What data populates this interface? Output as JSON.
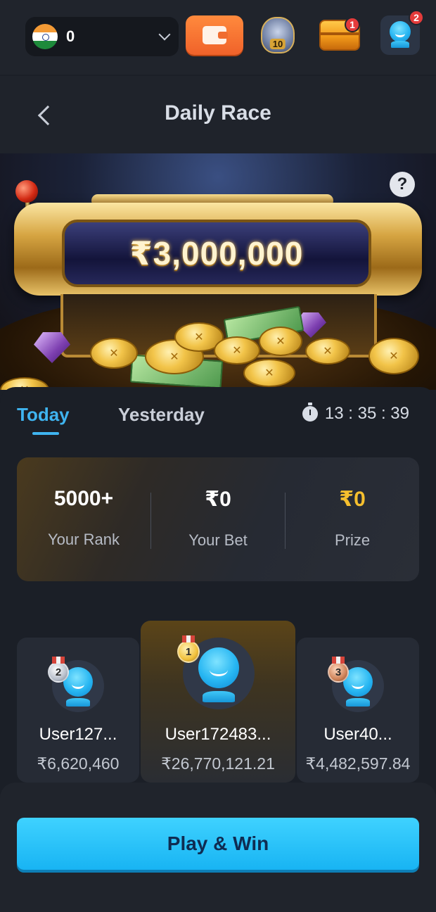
{
  "topbar": {
    "balance": "0",
    "currency_flag": "india-flag-icon",
    "wallet_icon": "wallet-icon",
    "pot_label": "10",
    "chest_badge": "1",
    "profile_badge": "2"
  },
  "header": {
    "title": "Daily Race"
  },
  "banner": {
    "jackpot": "₹3,000,000",
    "help_label": "?"
  },
  "tabs": {
    "today": "Today",
    "yesterday": "Yesterday",
    "timer": "13 : 35 : 39"
  },
  "stats": {
    "rank_value": "5000+",
    "rank_label": "Your Rank",
    "bet_value": "₹0",
    "bet_label": "Your Bet",
    "prize_value": "₹0",
    "prize_label": "Prize"
  },
  "podium": [
    {
      "rank": "2",
      "name": "User127...",
      "amount": "₹6,620,460"
    },
    {
      "rank": "1",
      "name": "User172483...",
      "amount": "₹26,770,121.21"
    },
    {
      "rank": "3",
      "name": "User40...",
      "amount": "₹4,482,597.84"
    }
  ],
  "cta": {
    "play_label": "Play & Win"
  },
  "colors": {
    "accent": "#3fb4f0",
    "button": "#18b4f3",
    "gold": "#f5bf2e",
    "background": "#1b1f27"
  }
}
